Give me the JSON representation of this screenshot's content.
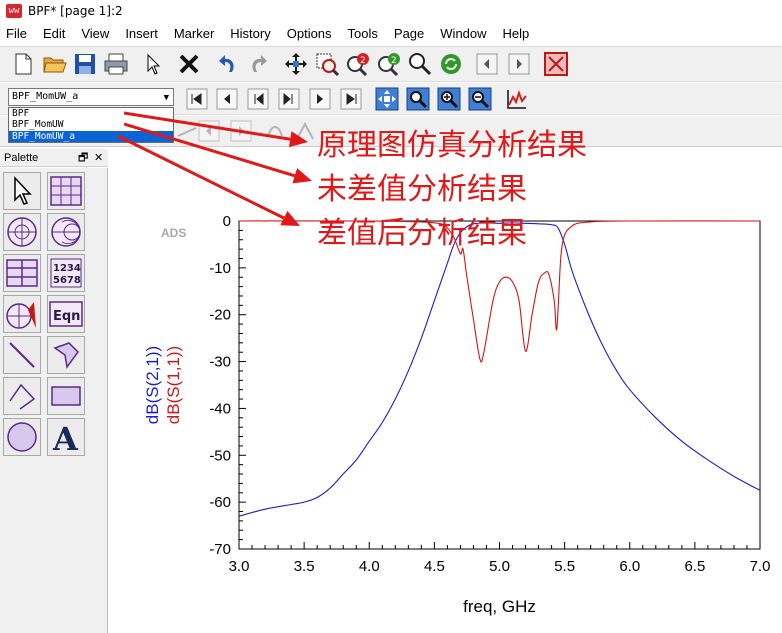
{
  "window": {
    "title": "BPF* [page 1]:2",
    "app_icon_text": "ww"
  },
  "menu": [
    "File",
    "Edit",
    "View",
    "Insert",
    "Marker",
    "History",
    "Options",
    "Tools",
    "Page",
    "Window",
    "Help"
  ],
  "dataset": {
    "selected": "BPF_MomUW_a",
    "options": [
      "BPF",
      "BPF_MomUW",
      "BPF_MomUW_a"
    ]
  },
  "palette": {
    "title": "Palette",
    "counter_label": "1234\n5678",
    "eqn_label": "Eqn",
    "text_label": "A"
  },
  "annotations": [
    "原理图仿真分析结果",
    "未差值分析结果",
    "差值后分析结果"
  ],
  "colors": {
    "s21": "#1c1ccf",
    "s11": "#d41414",
    "annotation": "#e01818",
    "accent": "#0a64d6"
  },
  "chart_data": {
    "type": "line",
    "watermark": "ADS",
    "xlabel": "freq, GHz",
    "ylabels": [
      "dB(S(2,1))",
      "dB(S(1,1))"
    ],
    "xlim": [
      3.0,
      7.0
    ],
    "ylim": [
      -70,
      0
    ],
    "xticks": [
      "3.0",
      "3.5",
      "4.0",
      "4.5",
      "5.0",
      "5.5",
      "6.0",
      "6.5",
      "7.0"
    ],
    "yticks": [
      "0",
      "-10",
      "-20",
      "-30",
      "-40",
      "-50",
      "-60",
      "-70"
    ],
    "grid": false,
    "series": [
      {
        "name": "dB(S(2,1))",
        "color": "#1c1ccf",
        "x": [
          3.0,
          3.2,
          3.4,
          3.5,
          3.6,
          3.7,
          3.8,
          3.9,
          4.0,
          4.1,
          4.2,
          4.3,
          4.4,
          4.5,
          4.6,
          4.65,
          4.7,
          4.75,
          4.8,
          4.9,
          5.0,
          5.1,
          5.2,
          5.3,
          5.4,
          5.45,
          5.5,
          5.55,
          5.6,
          5.7,
          5.8,
          5.9,
          6.0,
          6.2,
          6.4,
          6.6,
          6.8,
          7.0
        ],
        "y": [
          -63,
          -61.5,
          -60.5,
          -60,
          -59,
          -57,
          -54,
          -51,
          -47,
          -43,
          -38,
          -32,
          -25,
          -17,
          -9,
          -5,
          -2.5,
          -1.2,
          -0.6,
          -0.4,
          -0.5,
          -0.4,
          -0.5,
          -0.6,
          -0.8,
          -1.5,
          -5,
          -10,
          -14,
          -21,
          -27,
          -32,
          -36,
          -42,
          -47,
          -51,
          -54.5,
          -57.5
        ]
      },
      {
        "name": "dB(S(1,1))",
        "color": "#d41414",
        "x": [
          3.0,
          4.0,
          4.4,
          4.55,
          4.6,
          4.65,
          4.7,
          4.72,
          4.75,
          4.8,
          4.85,
          4.88,
          4.95,
          5.0,
          5.05,
          5.1,
          5.15,
          5.2,
          5.25,
          5.3,
          5.35,
          5.38,
          5.42,
          5.44,
          5.47,
          5.5,
          5.55,
          5.6,
          5.7,
          5.8,
          6.0,
          7.0
        ],
        "y": [
          0,
          0,
          -0.2,
          -0.6,
          -1.5,
          -3.5,
          -7,
          -6,
          -12,
          -21,
          -29.5,
          -28,
          -17,
          -13,
          -12,
          -13,
          -17,
          -27.8,
          -20,
          -13,
          -11,
          -11.5,
          -17,
          -23,
          -8,
          -3,
          -1.2,
          -0.5,
          -0.2,
          -0.05,
          0,
          0
        ]
      }
    ]
  }
}
